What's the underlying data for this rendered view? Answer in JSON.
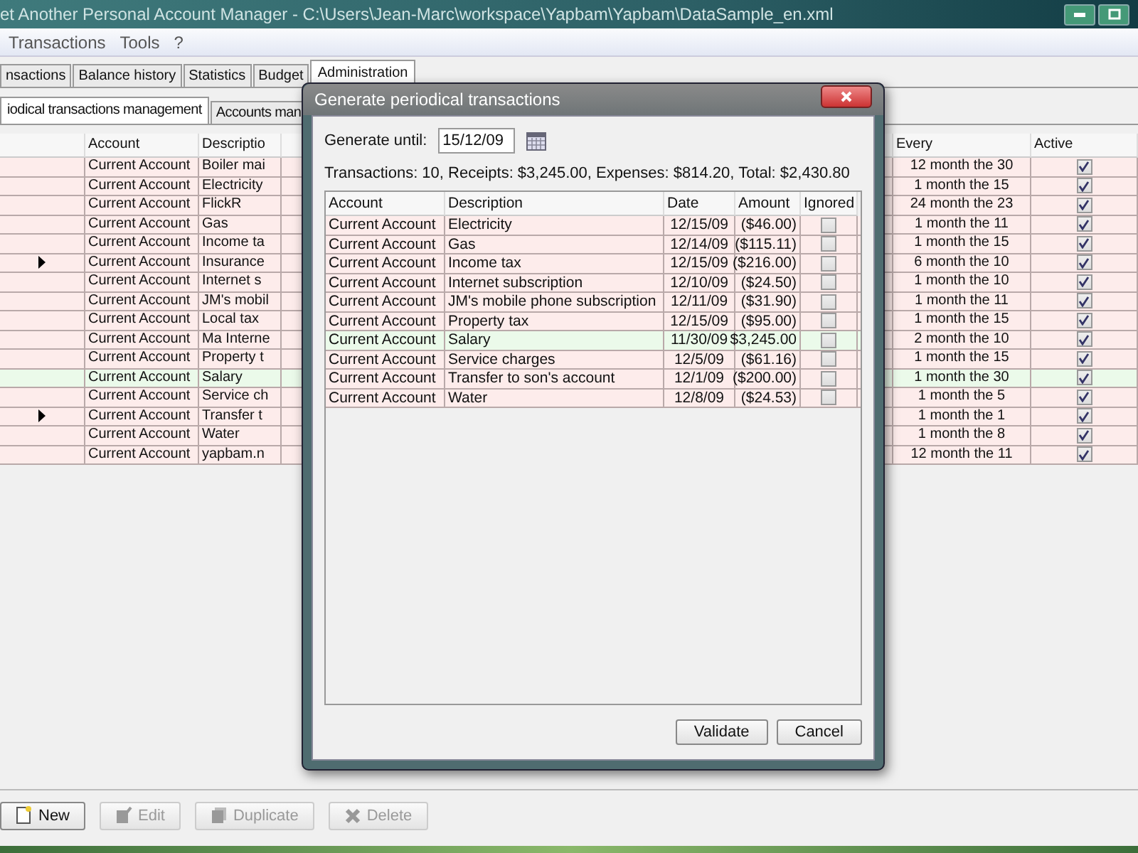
{
  "window": {
    "title": "et Another Personal Account Manager - C:\\Users\\Jean-Marc\\workspace\\Yapbam\\Yapbam\\DataSample_en.xml"
  },
  "menu": [
    "Transactions",
    "Tools",
    "?"
  ],
  "tabs": [
    {
      "label": "nsactions",
      "selected": false
    },
    {
      "label": "Balance history",
      "selected": false
    },
    {
      "label": "Statistics",
      "selected": false
    },
    {
      "label": "Budget",
      "selected": false
    },
    {
      "label": "Administration",
      "selected": true
    }
  ],
  "subtabs": [
    {
      "label": "iodical transactions management",
      "selected": true
    },
    {
      "label": "Accounts man",
      "selected": false
    }
  ],
  "table": {
    "columns": [
      "Account",
      "Descriptio",
      "Every",
      "Active"
    ],
    "rows": [
      {
        "marker": false,
        "account": "Current Account",
        "description": "Boiler mai",
        "every": "12 month the 30",
        "active": true,
        "color": "#fdeceb"
      },
      {
        "marker": false,
        "account": "Current Account",
        "description": "Electricity",
        "every": "1 month the 15",
        "active": true,
        "color": "#fdeceb"
      },
      {
        "marker": false,
        "account": "Current Account",
        "description": "FlickR",
        "every": "24 month the 23",
        "active": true,
        "color": "#fdeceb"
      },
      {
        "marker": false,
        "account": "Current Account",
        "description": "Gas",
        "every": "1 month the 11",
        "active": true,
        "color": "#fdeceb"
      },
      {
        "marker": false,
        "account": "Current Account",
        "description": "Income ta",
        "every": "1 month the 15",
        "active": true,
        "color": "#fdeceb"
      },
      {
        "marker": true,
        "account": "Current Account",
        "description": "Insurance",
        "every": "6 month the 10",
        "active": true,
        "color": "#fdeceb"
      },
      {
        "marker": false,
        "account": "Current Account",
        "description": "Internet s",
        "every": "1 month the 10",
        "active": true,
        "color": "#fdeceb"
      },
      {
        "marker": false,
        "account": "Current Account",
        "description": "JM's mobil",
        "every": "1 month the 11",
        "active": true,
        "color": "#fdeceb"
      },
      {
        "marker": false,
        "account": "Current Account",
        "description": "Local tax",
        "every": "1 month the 15",
        "active": true,
        "color": "#fdeceb"
      },
      {
        "marker": false,
        "account": "Current Account",
        "description": "Ma Interne",
        "every": "2 month the 10",
        "active": true,
        "color": "#fdeceb"
      },
      {
        "marker": false,
        "account": "Current Account",
        "description": "Property t",
        "every": "1 month the 15",
        "active": true,
        "color": "#fdeceb"
      },
      {
        "marker": false,
        "account": "Current Account",
        "description": "Salary",
        "every": "1 month the 30",
        "active": true,
        "color": "#ebfaea"
      },
      {
        "marker": false,
        "account": "Current Account",
        "description": "Service ch",
        "every": "1 month the 5",
        "active": true,
        "color": "#fdeceb"
      },
      {
        "marker": true,
        "account": "Current Account",
        "description": "Transfer t",
        "every": "1 month the 1",
        "active": true,
        "color": "#fdeceb"
      },
      {
        "marker": false,
        "account": "Current Account",
        "description": "Water",
        "every": "1 month the 8",
        "active": true,
        "color": "#fdeceb"
      },
      {
        "marker": false,
        "account": "Current Account",
        "description": "yapbam.n",
        "every": "12 month the 11",
        "active": true,
        "color": "#fdeceb"
      }
    ]
  },
  "buttons": [
    {
      "label": "New",
      "disabled": false
    },
    {
      "label": "Edit",
      "disabled": true
    },
    {
      "label": "Duplicate",
      "disabled": true
    },
    {
      "label": "Delete",
      "disabled": true
    }
  ],
  "dialog": {
    "title": "Generate periodical transactions",
    "until_label": "Generate until:",
    "until_value": "15/12/09",
    "summary": "Transactions: 10, Receipts: $3,245.00, Expenses: $814.20, Total: $2,430.80",
    "columns": [
      "Account",
      "Description",
      "Date",
      "Amount",
      "Ignored"
    ],
    "rows": [
      {
        "account": "Current Account",
        "description": "Electricity",
        "date": "12/15/09",
        "amount": "($46.00)",
        "ignored": false,
        "color": "#fdeceb"
      },
      {
        "account": "Current Account",
        "description": "Gas",
        "date": "12/14/09",
        "amount": "($115.11)",
        "ignored": false,
        "color": "#fdeceb"
      },
      {
        "account": "Current Account",
        "description": "Income tax",
        "date": "12/15/09",
        "amount": "($216.00)",
        "ignored": false,
        "color": "#fdeceb"
      },
      {
        "account": "Current Account",
        "description": "Internet subscription",
        "date": "12/10/09",
        "amount": "($24.50)",
        "ignored": false,
        "color": "#fdeceb"
      },
      {
        "account": "Current Account",
        "description": "JM's mobile phone subscription",
        "date": "12/11/09",
        "amount": "($31.90)",
        "ignored": false,
        "color": "#fdeceb"
      },
      {
        "account": "Current Account",
        "description": "Property tax",
        "date": "12/15/09",
        "amount": "($95.00)",
        "ignored": false,
        "color": "#fdeceb"
      },
      {
        "account": "Current Account",
        "description": "Salary",
        "date": "11/30/09",
        "amount": "$3,245.00",
        "ignored": false,
        "color": "#ebfaea"
      },
      {
        "account": "Current Account",
        "description": "Service charges",
        "date": "12/5/09",
        "amount": "($61.16)",
        "ignored": false,
        "color": "#fdeceb"
      },
      {
        "account": "Current Account",
        "description": "Transfer to son's account",
        "date": "12/1/09",
        "amount": "($200.00)",
        "ignored": false,
        "color": "#fdeceb"
      },
      {
        "account": "Current Account",
        "description": "Water",
        "date": "12/8/09",
        "amount": "($24.53)",
        "ignored": false,
        "color": "#fdeceb"
      }
    ],
    "buttons": [
      "Validate",
      "Cancel"
    ]
  }
}
